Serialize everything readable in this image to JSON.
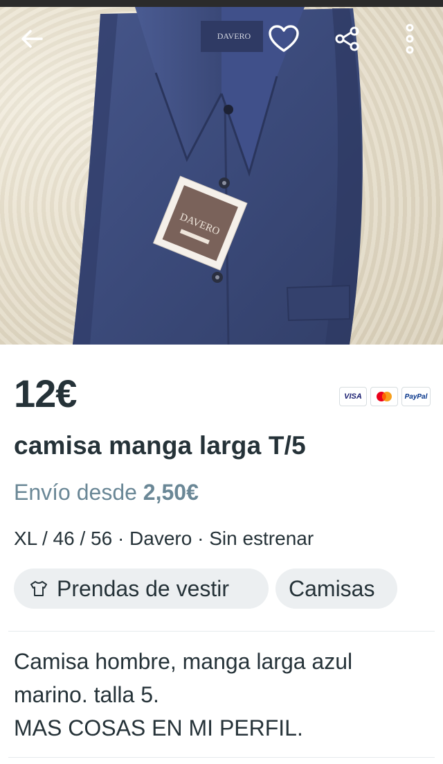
{
  "header": {
    "back_icon": "arrow-left-icon",
    "favorite_icon": "heart-icon",
    "share_icon": "share-icon",
    "more_icon": "more-vertical-icon"
  },
  "photo": {
    "brand_text": "DAVERO"
  },
  "product": {
    "price": "12€",
    "title": "camisa manga larga T/5",
    "shipping_prefix": "Envío desde",
    "shipping_price": "2,50€",
    "attributes": "XL / 46 / 56 · Davero · Sin estrenar",
    "payment_methods": [
      "VISA",
      "Mastercard",
      "PayPal"
    ]
  },
  "categories": [
    {
      "label": "Prendas de vestir",
      "icon": "tshirt-icon"
    },
    {
      "label": "Camisas"
    }
  ],
  "description": {
    "lines": [
      "Camisa hombre, manga larga azul",
      "marino. talla 5.",
      "MAS COSAS EN MI PERFIL."
    ]
  },
  "colors": {
    "text": "#253238",
    "muted": "#6a8796",
    "chip_bg": "#eceff1",
    "shirt": "#3c4a78"
  }
}
